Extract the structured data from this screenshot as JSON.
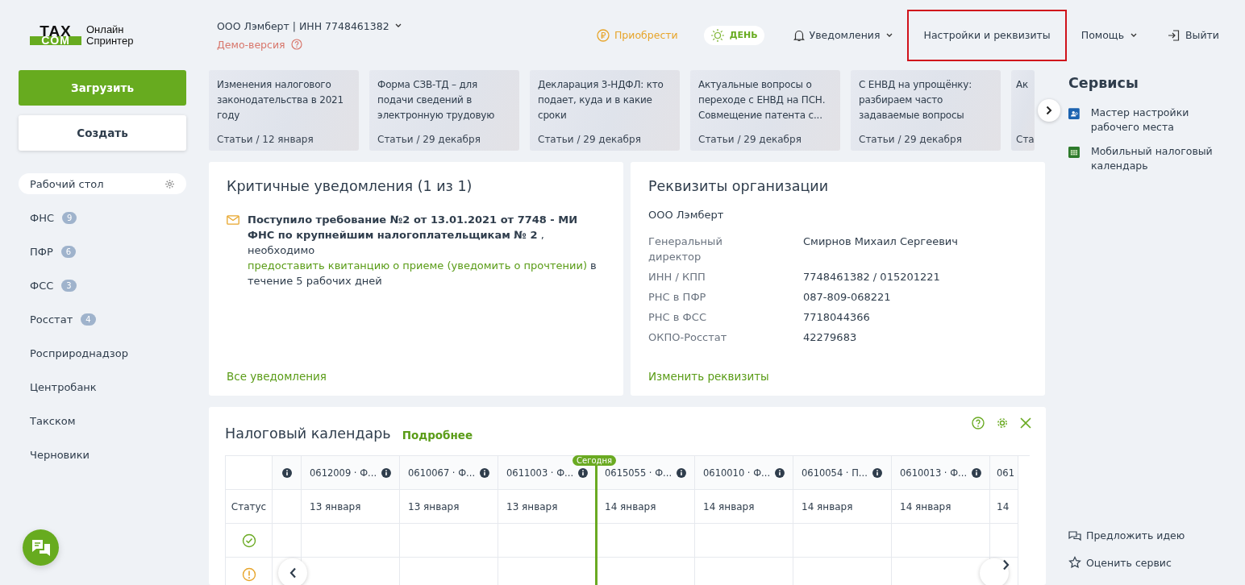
{
  "logo": {
    "mark_top": "TAX",
    "mark_bottom": "COM",
    "line_1": "Онлайн",
    "line_2": "Спринтер"
  },
  "org": {
    "name": "ООО Лэмберт | ИНН 7748461382",
    "demo": "Демо-версия"
  },
  "nav": [
    {
      "kind": "buy",
      "label": "Приобрести",
      "highlighted": false
    },
    {
      "kind": "theme",
      "label": "ДЕНЬ",
      "highlighted": false
    },
    {
      "kind": "bell",
      "label": "Уведомления",
      "highlighted": false
    },
    {
      "kind": "plain",
      "label": "Настройки и реквизиты",
      "highlighted": true
    },
    {
      "kind": "menu",
      "label": "Помощь",
      "highlighted": false
    },
    {
      "kind": "exit",
      "label": "Выйти",
      "highlighted": false
    }
  ],
  "actions": [
    {
      "kind": "primary",
      "label": "Загрузить"
    },
    {
      "kind": "secondary",
      "label": "Создать"
    }
  ],
  "sidebar": [
    {
      "label": "Рабочий стол",
      "selected": true
    },
    {
      "label": "ФНС",
      "count": "9",
      "selected": false
    },
    {
      "label": "ПФР",
      "count": "6",
      "selected": false
    },
    {
      "label": "ФСС",
      "count": "3",
      "selected": false
    },
    {
      "label": "Росстат",
      "count": "4",
      "selected": false
    },
    {
      "label": "Росприроднадзор",
      "selected": false
    },
    {
      "label": "Центробанк",
      "selected": false
    },
    {
      "label": "Такском",
      "selected": false
    },
    {
      "label": "Черновики",
      "selected": false
    }
  ],
  "news": [
    {
      "title": "Изменения налогового законодательства в 2021 году",
      "meta": "Статьи / 12 января"
    },
    {
      "title": "Форма СЗВ-ТД – для подачи сведений в электронную трудовую",
      "meta": "Статьи / 29 декабря"
    },
    {
      "title": "Декларация 3-НДФЛ: кто подает, куда и в какие сроки",
      "meta": "Статьи / 29 декабря"
    },
    {
      "title": "Актуальные вопросы о переходе с ЕНВД на ПСН. Совмещение патента с...",
      "meta": "Статьи / 29 декабря"
    },
    {
      "title": "С ЕНВД на упрощёнку: разбираем часто задаваемые вопросы",
      "meta": "Статьи / 29 декабря"
    },
    {
      "title": "Ак",
      "meta": "Ста",
      "cut": true
    }
  ],
  "notifications": {
    "title": "Критичные уведомления (1 из 1)",
    "message": "**Поступило требование №2 от 13.01.2021 от 7748 - МИ ФНС по крупнейшим налогоплательщикам № 2** , необходимо",
    "link": "предоставить квитанцию о приеме (уведомить о прочтении)",
    "tail": "в течение 5 рабочих дней",
    "all": "Все уведомления"
  },
  "requisites": {
    "title": "Реквизиты организации",
    "org": "ООО Лэмберт",
    "rows": [
      {
        "label": "Генеральный директор",
        "value": "Смирнов Михаил Сергеевич"
      },
      {
        "label": "ИНН / КПП",
        "value": "7748461382 / 015201221"
      },
      {
        "label": "РНС в ПФР",
        "value": "087-809-068221"
      },
      {
        "label": "РНС в ФСС",
        "value": "7718044366"
      },
      {
        "label": "ОКПО-Росстат",
        "value": "42279683"
      }
    ],
    "edit": "Изменить реквизиты"
  },
  "calendar": {
    "title": "Налоговый календарь",
    "more": "Подробнее",
    "status_label": "Статус",
    "today_label": "Сегодня",
    "columns": [
      {
        "code": "0612009 · Ф...",
        "date": "13 января",
        "today": false,
        "cut": false
      },
      {
        "code": "0610067 · Ф...",
        "date": "13 января",
        "today": false,
        "cut": false
      },
      {
        "code": "0611003 · Ф...",
        "date": "13 января",
        "today": false,
        "cut": false
      },
      {
        "code": "0615055 · Ф...",
        "date": "14 января",
        "today": true,
        "cut": false
      },
      {
        "code": "0610010 · Ф...",
        "date": "14 января",
        "today": false,
        "cut": false
      },
      {
        "code": "0610054 · П...",
        "date": "14 января",
        "today": false,
        "cut": false
      },
      {
        "code": "0610013 · Ф...",
        "date": "14 января",
        "today": false,
        "cut": false
      },
      {
        "code": "061",
        "date": "14",
        "today": false,
        "cut": true
      }
    ],
    "rows": [
      {
        "kind": "done"
      },
      {
        "kind": "warning"
      }
    ]
  },
  "services": {
    "title": "Сервисы",
    "items": [
      {
        "kind": "wizard",
        "label": "Мастер настройки рабочего места"
      },
      {
        "kind": "calendar",
        "label": "Мобильный налоговый календарь"
      }
    ]
  },
  "footer_links": [
    {
      "kind": "idea",
      "label": "Предложить идею"
    },
    {
      "kind": "star",
      "label": "Оценить сервис"
    }
  ]
}
